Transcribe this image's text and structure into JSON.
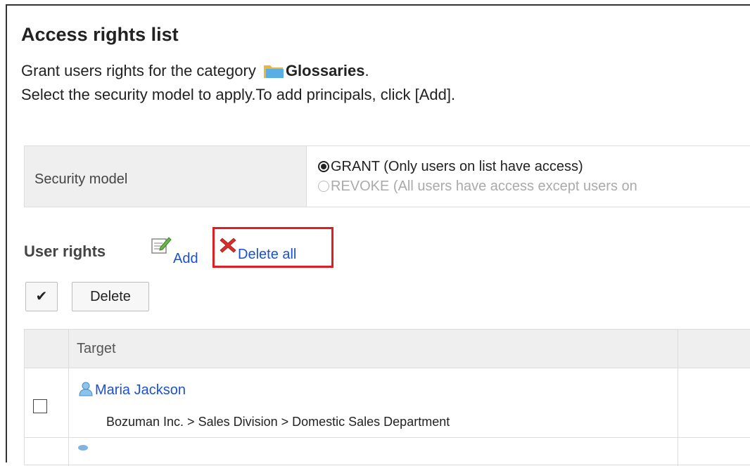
{
  "page": {
    "title": "Access rights list",
    "desc_prefix": "Grant users rights for the category ",
    "category_name": "Glossaries",
    "desc_suffix": ".",
    "desc_line2": "Select the security model to apply.To add principals, click [Add]."
  },
  "security": {
    "label": "Security model",
    "options": [
      {
        "label": "GRANT (Only users on list have access)",
        "selected": true
      },
      {
        "label": "REVOKE (All users have access except users on",
        "selected": false
      }
    ]
  },
  "user_rights": {
    "label": "User rights",
    "add_label": "Add",
    "delete_all_label": "Delete all"
  },
  "toolbar": {
    "check_all_glyph": "✔",
    "delete_label": "Delete"
  },
  "table": {
    "header_target": "Target",
    "rows": [
      {
        "name": "Maria Jackson",
        "org_path": "Bozuman Inc. > Sales Division > Domestic Sales Department",
        "checked": false
      }
    ]
  },
  "colors": {
    "link": "#1a4fd6",
    "highlight": "#e01c24",
    "header_bg": "#efefef"
  }
}
